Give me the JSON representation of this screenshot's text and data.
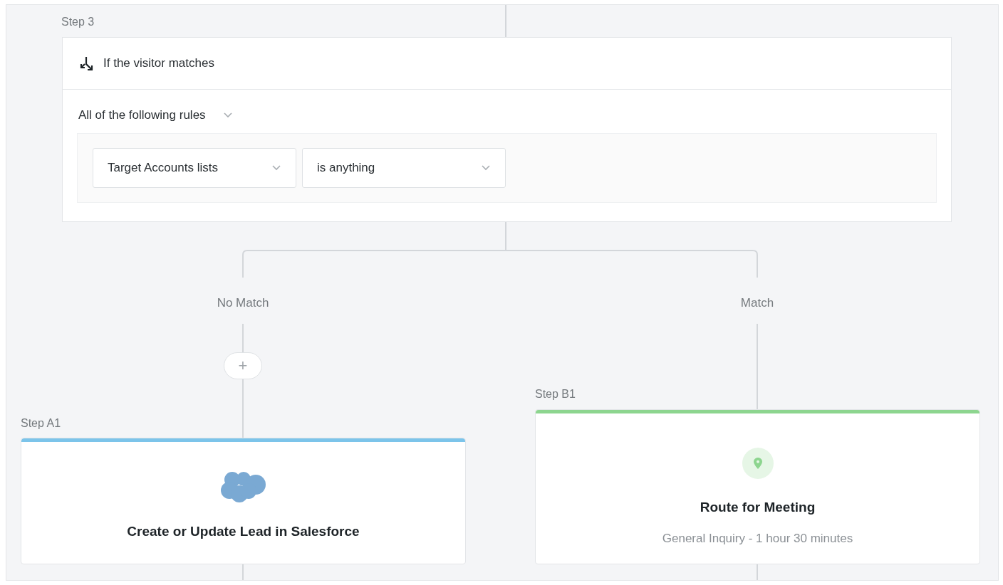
{
  "condition_step": {
    "step_label": "Step 3",
    "title": "If the visitor matches",
    "match_mode": "All of the following rules",
    "rules": [
      {
        "field": "Target Accounts lists",
        "operator": "is anything"
      }
    ]
  },
  "branches": [
    {
      "label": "No Match",
      "add_button": "+",
      "step_label": "Step A1",
      "card": {
        "kind": "salesforce",
        "color": "#7cc4ea",
        "title": "Create or Update Lead in Salesforce"
      }
    },
    {
      "label": "Match",
      "step_label": "Step B1",
      "card": {
        "kind": "route",
        "color": "#8dd58f",
        "title": "Route for Meeting",
        "subtitle": "General Inquiry - 1 hour 30 minutes"
      }
    }
  ]
}
